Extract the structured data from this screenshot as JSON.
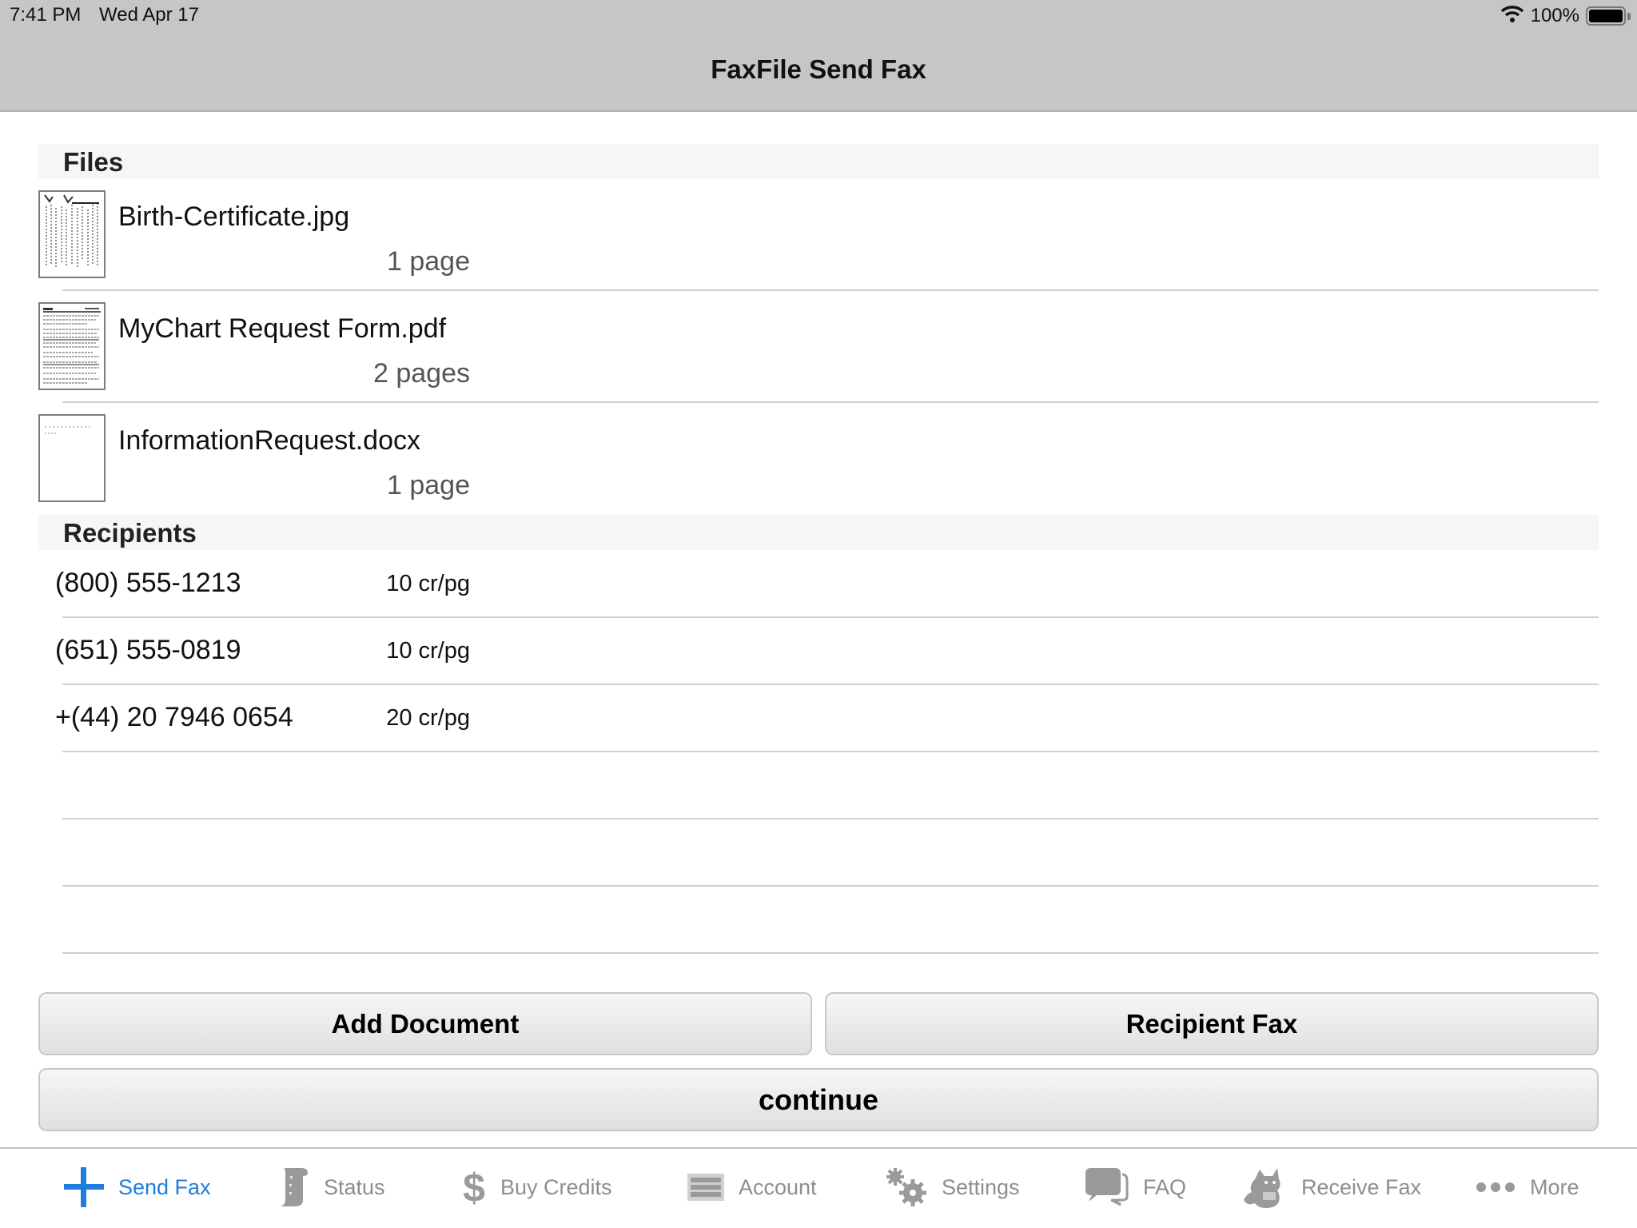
{
  "status_bar": {
    "time": "7:41 PM",
    "date": "Wed Apr 17",
    "battery": "100%",
    "wifi_icon": "wifi-icon",
    "battery_icon": "battery-icon"
  },
  "nav": {
    "title": "FaxFile Send Fax"
  },
  "files": {
    "header": "Files",
    "items": [
      {
        "name": "Birth-Certificate.jpg",
        "pages": "1 page",
        "thumbnail": "scanned-certificate-thumbnail"
      },
      {
        "name": "MyChart Request Form.pdf",
        "pages": "2 pages",
        "thumbnail": "form-document-thumbnail"
      },
      {
        "name": "InformationRequest.docx",
        "pages": "1 page",
        "thumbnail": "blank-document-thumbnail"
      }
    ]
  },
  "recipients": {
    "header": "Recipients",
    "items": [
      {
        "number": "(800) 555-1213",
        "rate": "10 cr/pg"
      },
      {
        "number": "(651) 555-0819",
        "rate": "10 cr/pg"
      },
      {
        "number": "+(44) 20 7946 0654",
        "rate": "20 cr/pg"
      }
    ]
  },
  "buttons": {
    "add_document": "Add Document",
    "recipient_fax": "Recipient Fax",
    "continue": "continue"
  },
  "tabbar": {
    "active_color": "#1f7de0",
    "inactive_color": "#8e8e8e",
    "items": [
      {
        "label": "Send Fax",
        "icon": "plus-icon",
        "active": true
      },
      {
        "label": "Status",
        "icon": "scroll-icon",
        "active": false
      },
      {
        "label": "Buy Credits",
        "icon": "dollar-icon",
        "active": false
      },
      {
        "label": "Account",
        "icon": "list-icon",
        "active": false
      },
      {
        "label": "Settings",
        "icon": "gears-icon",
        "active": false
      },
      {
        "label": "FAQ",
        "icon": "chat-bubbles-icon",
        "active": false
      },
      {
        "label": "Receive Fax",
        "icon": "fox-mascot-icon",
        "active": false
      },
      {
        "label": "More",
        "icon": "more-dots-icon",
        "active": false
      }
    ]
  }
}
